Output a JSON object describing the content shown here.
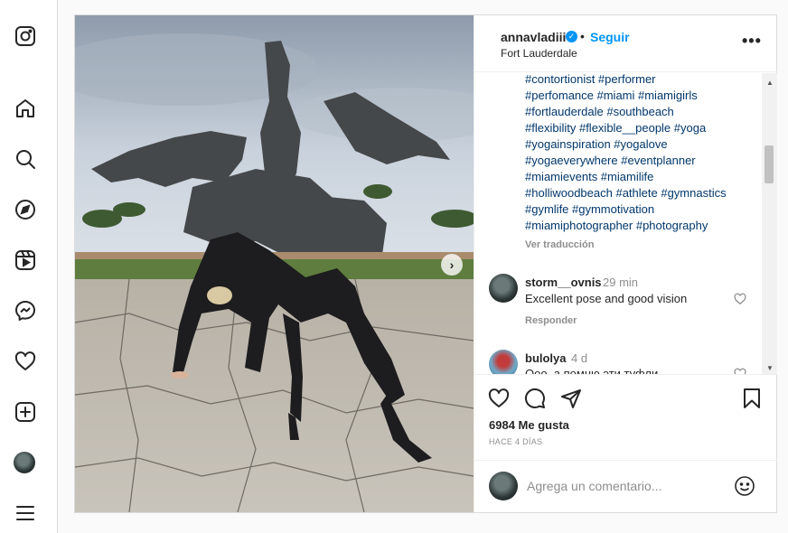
{
  "post": {
    "username": "annavladiii",
    "verified_mark": "✓",
    "separator": "•",
    "follow_label": "Seguir",
    "location": "Fort Lauderdale",
    "more_label": "•••",
    "next_arrow": "›"
  },
  "caption": {
    "hashtag_lines": [
      "#contortionist #performer",
      "#perfomance #miami #miamigirls",
      "#fortlauderdale #southbeach",
      "#flexibility #flexible__people #yoga",
      "#yogainspiration #yogalove",
      "#yogaeverywhere #eventplanner",
      "#miamievents #miamilife",
      "#holliwoodbeach #athlete #gymnastics",
      "#gymlife #gymmotivation",
      "#miamiphotographer #photography"
    ],
    "translate_label": "Ver traducción"
  },
  "comments": [
    {
      "user": "storm__ovnis",
      "time": "29 min",
      "text": "Excellent pose and good vision",
      "reply_label": "Responder"
    },
    {
      "user": "bulolya",
      "time": "4 d",
      "text": "Ооо, а помню эти туфли"
    }
  ],
  "stats": {
    "likes": "6984 Me gusta",
    "ago": "HACE 4 DÍAS"
  },
  "composer": {
    "placeholder": "Agrega un comentario..."
  },
  "scrollbar": {
    "up": "▲",
    "down": "▼"
  },
  "icons": {
    "sidebar": [
      "instagram-icon",
      "home-icon",
      "search-icon",
      "explore-icon",
      "reels-icon",
      "messenger-icon",
      "heart-icon",
      "create-icon",
      "profile-avatar",
      "menu-icon"
    ],
    "actions": [
      "like-icon",
      "comment-icon",
      "share-icon",
      "save-icon"
    ]
  },
  "colors": {
    "accent": "#0095f6",
    "hashtag": "#00376b",
    "muted": "#8e8e8e",
    "text": "#262626"
  }
}
